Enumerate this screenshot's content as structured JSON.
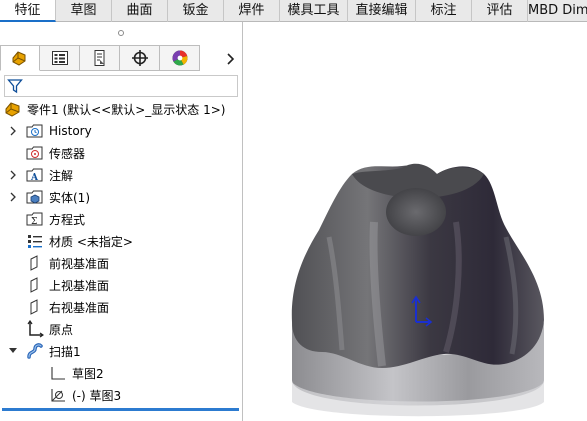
{
  "tabs": [
    {
      "label": "特征",
      "active": true
    },
    {
      "label": "草图"
    },
    {
      "label": "曲面"
    },
    {
      "label": "钣金"
    },
    {
      "label": "焊件"
    },
    {
      "label": "模具工具"
    },
    {
      "label": "直接编辑"
    },
    {
      "label": "标注"
    },
    {
      "label": "评估"
    },
    {
      "label": "MBD Dim"
    }
  ],
  "panel_tabs": [
    "feature-manager-icon",
    "property-manager-icon",
    "configuration-manager-icon",
    "dimxpert-manager-icon",
    "display-manager-icon"
  ],
  "tree": {
    "root": "零件1 (默认<<默认>_显示状态 1>)",
    "items": [
      {
        "label": "History",
        "icon": "history-folder-icon",
        "expandable": true
      },
      {
        "label": "传感器",
        "icon": "sensors-icon"
      },
      {
        "label": "注解",
        "icon": "annotations-icon",
        "expandable": true
      },
      {
        "label": "实体(1)",
        "icon": "solid-bodies-icon",
        "expandable": true
      },
      {
        "label": "方程式",
        "icon": "equations-icon"
      },
      {
        "label": "材质 <未指定>",
        "icon": "material-icon"
      },
      {
        "label": "前视基准面",
        "icon": "plane-icon"
      },
      {
        "label": "上视基准面",
        "icon": "plane-icon"
      },
      {
        "label": "右视基准面",
        "icon": "plane-icon"
      },
      {
        "label": "原点",
        "icon": "origin-icon"
      },
      {
        "label": "扫描1",
        "icon": "sweep-icon",
        "expanded": true
      },
      {
        "label": "草图2",
        "icon": "sketch-icon",
        "child": true
      },
      {
        "label": "(-) 草图3",
        "icon": "sketch-3d-icon",
        "child": true
      }
    ]
  },
  "colors": {
    "accent": "#1a6fc8",
    "model_dark": "#3a3a3e",
    "model_light": "#a8a8ac"
  }
}
